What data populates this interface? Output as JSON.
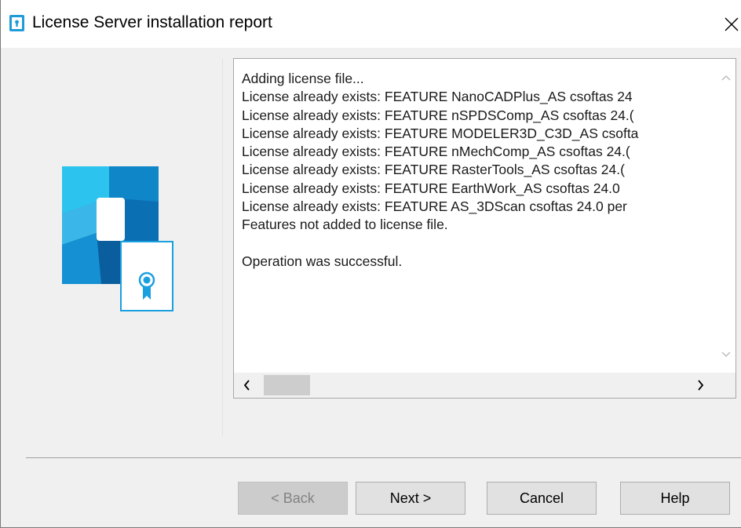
{
  "window": {
    "title": "License Server installation report",
    "icon": "license-server-app-icon",
    "close_icon": "close-icon"
  },
  "report": {
    "lines": [
      "Adding license file...",
      "License already exists: FEATURE NanoCADPlus_AS csoftas 24",
      "License already exists: FEATURE nSPDSComp_AS csoftas 24.(",
      "License already exists: FEATURE MODELER3D_C3D_AS csofta",
      "License already exists: FEATURE nMechComp_AS csoftas 24.(",
      "License already exists: FEATURE RasterTools_AS csoftas 24.(",
      "License already exists: FEATURE EarthWork_AS csoftas 24.0",
      "License already exists: FEATURE AS_3DScan csoftas 24.0 per",
      "Features not added to license file.",
      "",
      "Operation was successful."
    ],
    "horizontal_scroll_position": 0
  },
  "buttons": {
    "back": "< Back",
    "next": "Next >",
    "cancel": "Cancel",
    "help": "Help"
  },
  "colors": {
    "accent": "#1f9bd7",
    "window_background": "#f0f0f0"
  }
}
